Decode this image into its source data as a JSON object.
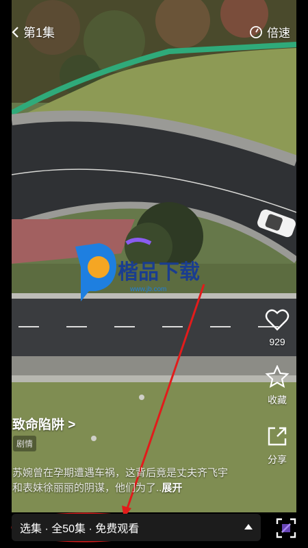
{
  "header": {
    "episode_label": "第1集",
    "speed_label": "倍速"
  },
  "actions": {
    "like_count": "929",
    "collect_label": "收藏",
    "share_label": "分享"
  },
  "drama": {
    "title": "致命陷阱 >",
    "tag": "剧情",
    "description": "苏婉曾在孕期遭遇车祸，这背后竟是丈夫齐飞宇和表妹徐丽丽的阴谋，他们为了..",
    "expand_label": "展开"
  },
  "episode_bar": {
    "label": "选集 · 全50集 · 免费观看"
  },
  "watermark": {
    "text": "楷品下载",
    "url": "www.jb.com"
  },
  "colors": {
    "annotation": "#e21b1b",
    "bar_bg": "#1c1c1c"
  }
}
